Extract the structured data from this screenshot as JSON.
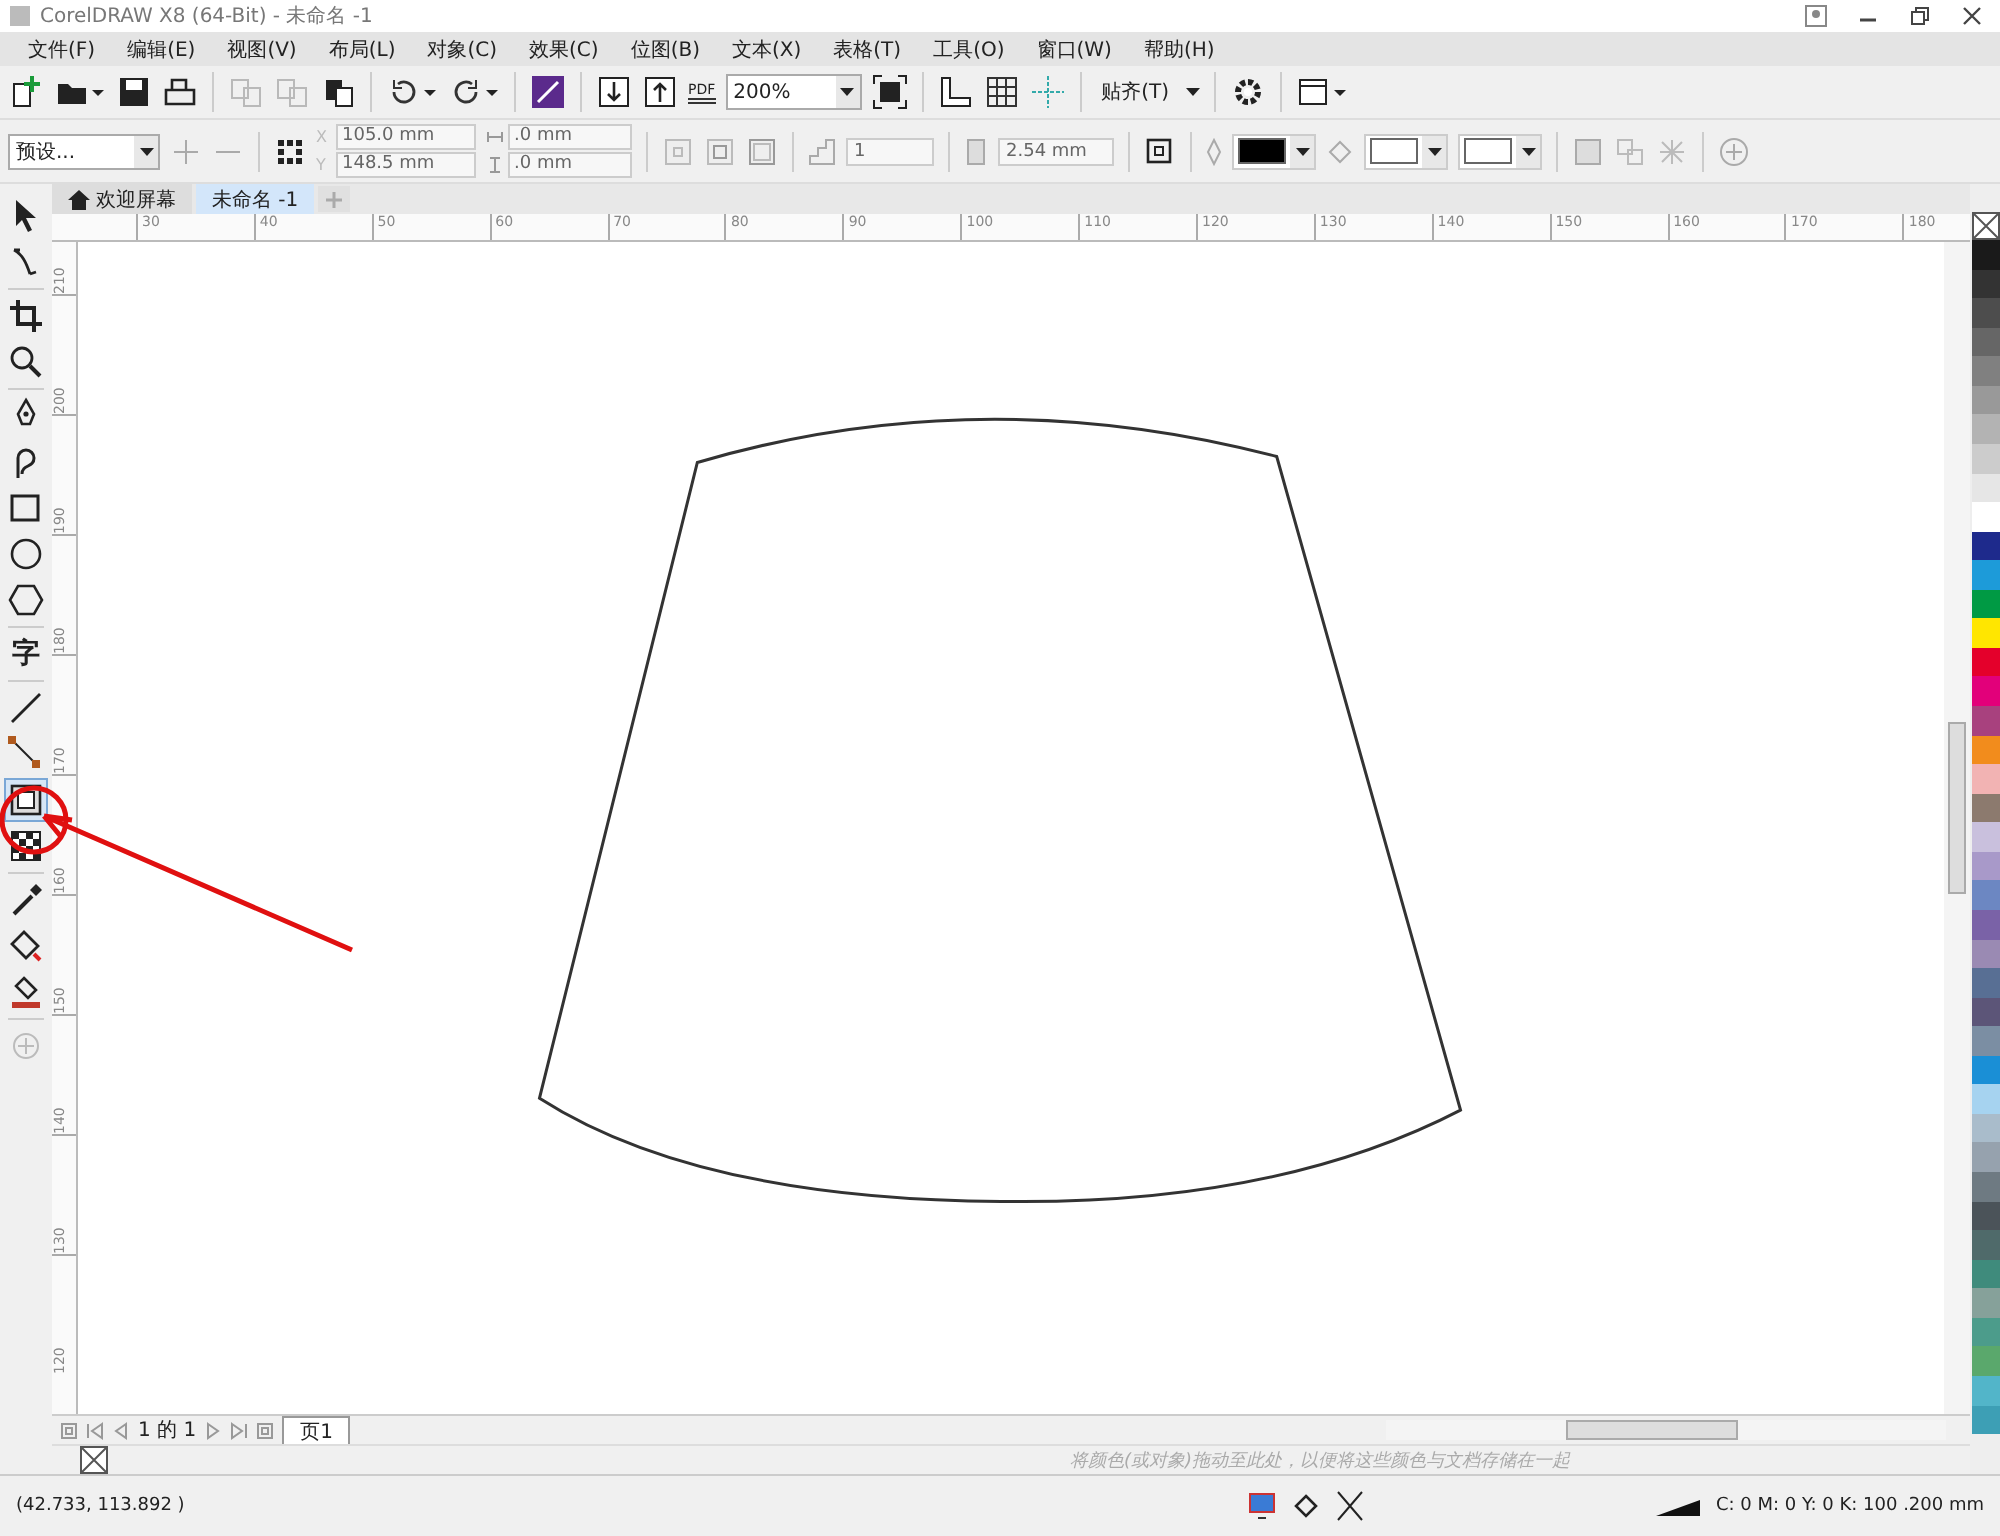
{
  "window": {
    "title": "CorelDRAW X8 (64-Bit) - 未命名 -1"
  },
  "menu": [
    "文件(F)",
    "编辑(E)",
    "视图(V)",
    "布局(L)",
    "对象(C)",
    "效果(C)",
    "位图(B)",
    "文本(X)",
    "表格(T)",
    "工具(O)",
    "窗口(W)",
    "帮助(H)"
  ],
  "toolbar": [
    {
      "kind": "new",
      "disabled": false
    },
    {
      "kind": "open",
      "disabled": false
    },
    {
      "kind": "save",
      "disabled": false
    },
    {
      "kind": "print",
      "disabled": false
    },
    {
      "kind": "sep"
    },
    {
      "kind": "cut",
      "disabled": true
    },
    {
      "kind": "copy",
      "disabled": true
    },
    {
      "kind": "paste",
      "disabled": false
    },
    {
      "kind": "sep"
    },
    {
      "kind": "undo",
      "disabled": false
    },
    {
      "kind": "redo",
      "disabled": false
    },
    {
      "kind": "sep"
    },
    {
      "kind": "launcher",
      "disabled": false
    },
    {
      "kind": "sep"
    },
    {
      "kind": "import",
      "disabled": false
    },
    {
      "kind": "export",
      "disabled": false
    },
    {
      "kind": "pdf",
      "disabled": false,
      "label": "PDF"
    },
    {
      "kind": "zoom",
      "disabled": false,
      "value": "200%"
    },
    {
      "kind": "fullscreen",
      "disabled": false
    },
    {
      "kind": "sep"
    },
    {
      "kind": "rulers",
      "disabled": false
    },
    {
      "kind": "grid",
      "disabled": false
    },
    {
      "kind": "guides",
      "disabled": false
    },
    {
      "kind": "sep"
    },
    {
      "kind": "snap",
      "disabled": false,
      "label": "贴齐(T)"
    },
    {
      "kind": "sep"
    },
    {
      "kind": "gear",
      "disabled": false
    },
    {
      "kind": "sep"
    },
    {
      "kind": "window",
      "disabled": false
    }
  ],
  "property_bar": {
    "preset": "预设...",
    "x_label": "X",
    "x": "105.0 mm",
    "y_label": "Y",
    "y": "148.5 mm",
    "w": ".0 mm",
    "h": ".0 mm",
    "steps": "1",
    "offset": "2.54 mm"
  },
  "tabs": [
    {
      "label": "欢迎屏幕",
      "selected": false
    },
    {
      "label": "未命名 -1",
      "selected": true
    }
  ],
  "ruler_h": [
    "30",
    "40",
    "50",
    "60",
    "70",
    "80",
    "90",
    "100",
    "110",
    "120",
    "130",
    "140",
    "150",
    "160",
    "170",
    "180"
  ],
  "ruler_v": [
    "210",
    "200",
    "190",
    "180",
    "170",
    "160",
    "150",
    "140",
    "130",
    "120"
  ],
  "tools": [
    {
      "kind": "pick",
      "selected": false
    },
    {
      "kind": "shape",
      "selected": false
    },
    {
      "kind": "sep"
    },
    {
      "kind": "crop",
      "selected": false
    },
    {
      "kind": "zoom",
      "selected": false
    },
    {
      "kind": "sep"
    },
    {
      "kind": "pen",
      "selected": false
    },
    {
      "kind": "curve",
      "selected": false
    },
    {
      "kind": "rect",
      "selected": false
    },
    {
      "kind": "ellipse",
      "selected": false
    },
    {
      "kind": "polygon",
      "selected": false
    },
    {
      "kind": "sep"
    },
    {
      "kind": "text",
      "selected": false,
      "label": "字"
    },
    {
      "kind": "sep"
    },
    {
      "kind": "line",
      "selected": false
    },
    {
      "kind": "connector",
      "selected": false
    },
    {
      "kind": "contour",
      "selected": true
    },
    {
      "kind": "transparency",
      "selected": false
    },
    {
      "kind": "sep"
    },
    {
      "kind": "eyedropper",
      "selected": false
    },
    {
      "kind": "fill",
      "selected": false
    },
    {
      "kind": "smartfill",
      "selected": false
    },
    {
      "kind": "sep"
    },
    {
      "kind": "add",
      "selected": false
    }
  ],
  "palette": [
    {
      "color": "#1a1a1a"
    },
    {
      "color": "#333333"
    },
    {
      "color": "#4d4d4d"
    },
    {
      "color": "#666666"
    },
    {
      "color": "#808080"
    },
    {
      "color": "#999999"
    },
    {
      "color": "#b3b3b3"
    },
    {
      "color": "#cccccc"
    },
    {
      "color": "#e6e6e6"
    },
    {
      "color": "#ffffff"
    },
    {
      "color": "#1e2a8c"
    },
    {
      "color": "#1d9bd9"
    },
    {
      "color": "#009a44"
    },
    {
      "color": "#ffe600"
    },
    {
      "color": "#e4002b"
    },
    {
      "color": "#e2007a"
    },
    {
      "color": "#a8417e"
    },
    {
      "color": "#f28c1c"
    },
    {
      "color": "#f2b3b3"
    },
    {
      "color": "#8c7a6e"
    },
    {
      "color": "#c9c0dd"
    },
    {
      "color": "#a899c9"
    },
    {
      "color": "#6c87c2"
    },
    {
      "color": "#7a62a7"
    },
    {
      "color": "#9a8ab3"
    },
    {
      "color": "#586f94"
    },
    {
      "color": "#5c5578"
    },
    {
      "color": "#7b8ea3"
    },
    {
      "color": "#1a8fd6"
    },
    {
      "color": "#a6d3f0"
    },
    {
      "color": "#a9bccb"
    },
    {
      "color": "#96a2ae"
    },
    {
      "color": "#6e7a82"
    },
    {
      "color": "#4b5359"
    },
    {
      "color": "#4f6a6a"
    },
    {
      "color": "#3f8b7c"
    },
    {
      "color": "#86a19a"
    },
    {
      "color": "#4c9c8b"
    },
    {
      "color": "#5aa86c"
    },
    {
      "color": "#52b5c9"
    },
    {
      "color": "#3d9fb5"
    }
  ],
  "page_nav": {
    "counter": "1 的 1",
    "page_tab": "页1"
  },
  "doc_palette": {
    "hint": "将颜色(或对象)拖动至此处，以便将这些颜色与文档存储在一起"
  },
  "status_bar": {
    "coords": "(42.733, 113.892 )",
    "outline": "C: 0 M: 0 Y: 0 K: 100  .200 mm"
  }
}
